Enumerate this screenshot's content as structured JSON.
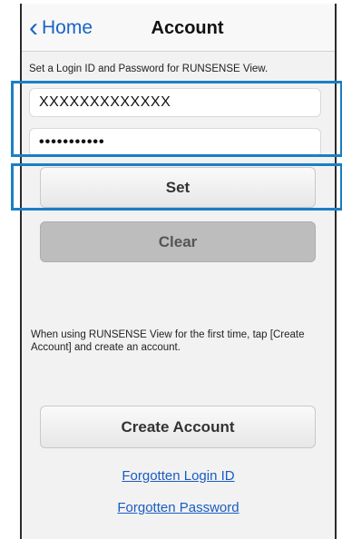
{
  "nav": {
    "back_label": "Home",
    "title": "Account"
  },
  "form": {
    "hint": "Set a Login ID and Password for RUNSENSE View.",
    "login_id_value": "XXXXXXXXXXXXX",
    "password_value": "•••••••••••"
  },
  "buttons": {
    "set_label": "Set",
    "clear_label": "Clear",
    "create_account_label": "Create Account"
  },
  "note": "When using RUNSENSE View for the first time, tap [Create Account] and create an account.",
  "links": {
    "forgotten_login_id": "Forgotten Login ID",
    "forgotten_password": "Forgotten Password"
  },
  "icons": {
    "back": "chevron-left-icon"
  },
  "colors": {
    "accent": "#1a64c8",
    "highlight": "#1a7fc4",
    "clear_button": "#bdbdbd"
  }
}
